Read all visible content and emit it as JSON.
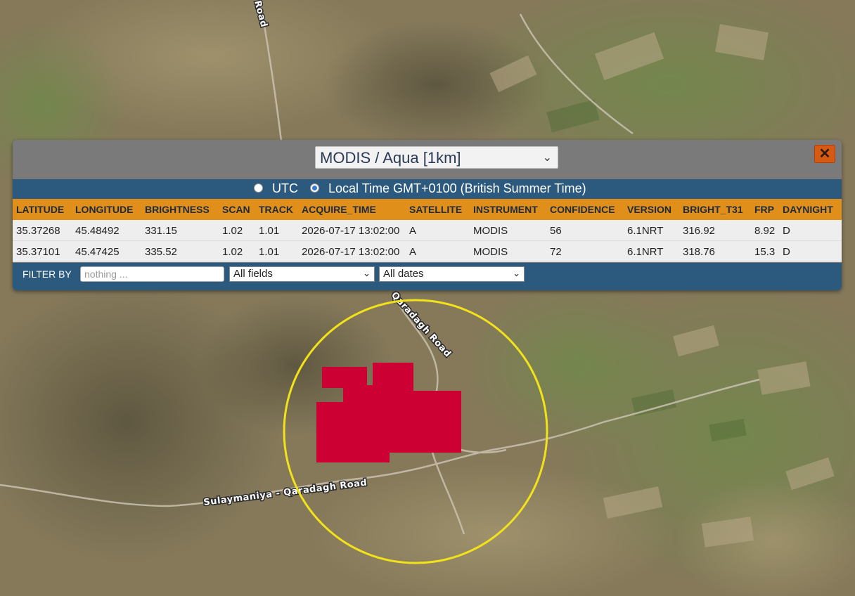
{
  "map": {
    "roads": [
      "Sulaymaniya - Qaradagh Road",
      "Qaradagh Road",
      "Road"
    ]
  },
  "panel": {
    "source": "MODIS / Aqua [1km]",
    "close_icon": "close-icon",
    "time_options": [
      {
        "label": "UTC",
        "selected": false
      },
      {
        "label": "Local Time GMT+0100 (British Summer Time)",
        "selected": true
      }
    ],
    "columns": [
      "LATITUDE",
      "LONGITUDE",
      "BRIGHTNESS",
      "SCAN",
      "TRACK",
      "ACQUIRE_TIME",
      "SATELLITE",
      "INSTRUMENT",
      "CONFIDENCE",
      "VERSION",
      "BRIGHT_T31",
      "FRP",
      "DAYNIGHT"
    ],
    "rows": [
      [
        "35.37268",
        "45.48492",
        "331.15",
        "1.02",
        "1.01",
        "2026-07-17 13:02:00",
        "A",
        "MODIS",
        "56",
        "6.1NRT",
        "316.92",
        "8.92",
        "D"
      ],
      [
        "35.37101",
        "45.47425",
        "335.52",
        "1.02",
        "1.01",
        "2026-07-17 13:02:00",
        "A",
        "MODIS",
        "72",
        "6.1NRT",
        "318.76",
        "15.3",
        "D"
      ]
    ],
    "filter": {
      "label": "FILTER BY",
      "placeholder": "nothing ...",
      "fields_value": "All fields",
      "dates_value": "All dates"
    }
  },
  "colors": {
    "fire_area": "#cc0033",
    "highlight_circle": "#f2e21a",
    "header_bar": "#e08f1a",
    "blue_bar": "#2c5a7e",
    "close_button": "#d65a14"
  }
}
